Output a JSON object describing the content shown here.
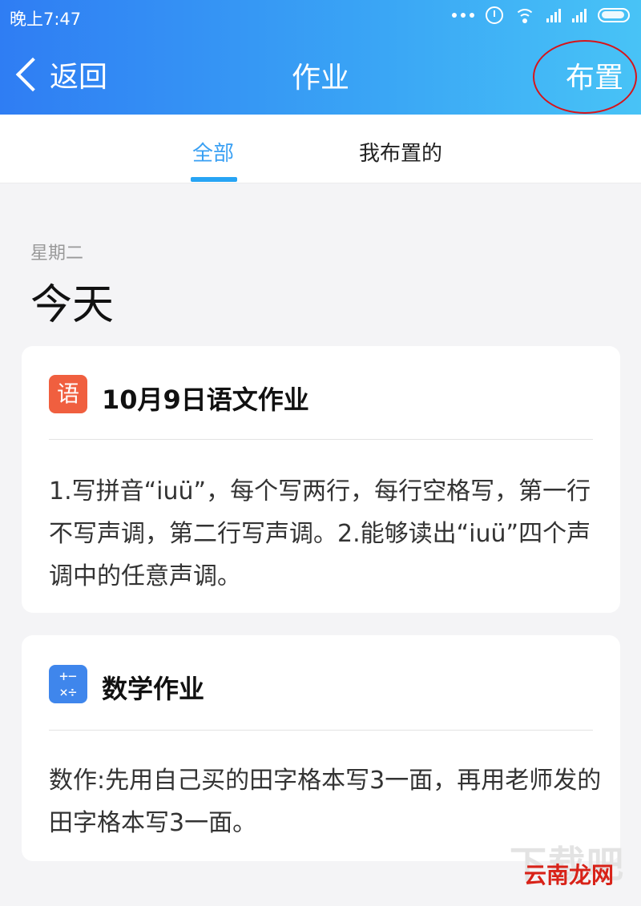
{
  "statusbar": {
    "time": "晚上7:47"
  },
  "header": {
    "back_label": "返回",
    "title": "作业",
    "assign_label": "布置"
  },
  "tabs": [
    {
      "label": "全部",
      "active": true
    },
    {
      "label": "我布置的",
      "active": false
    }
  ],
  "section": {
    "weekday": "星期二",
    "day_label": "今天"
  },
  "homework": [
    {
      "icon": "语",
      "icon_name": "chinese-subject-icon",
      "icon_color": "#f05f3f",
      "title": "10月9日语文作业",
      "body": "1.写拼音“iuü”，每个写两行，每行空格写，第一行不写声调，第二行写声调。2.能够读出“iuü”四个声调中的任意声调。"
    },
    {
      "icon": "+−×÷",
      "icon_name": "math-subject-icon",
      "icon_color": "#3f86ec",
      "title": "数学作业",
      "body": "数作:先用自己买的田字格本写3一面，再用老师发的田字格本写3一面。"
    }
  ],
  "watermark": {
    "text": "云南龙网",
    "bg_text": "下载吧"
  },
  "colors": {
    "accent": "#27a4f4",
    "header_start": "#2f7df3",
    "header_end": "#48c3f6"
  }
}
